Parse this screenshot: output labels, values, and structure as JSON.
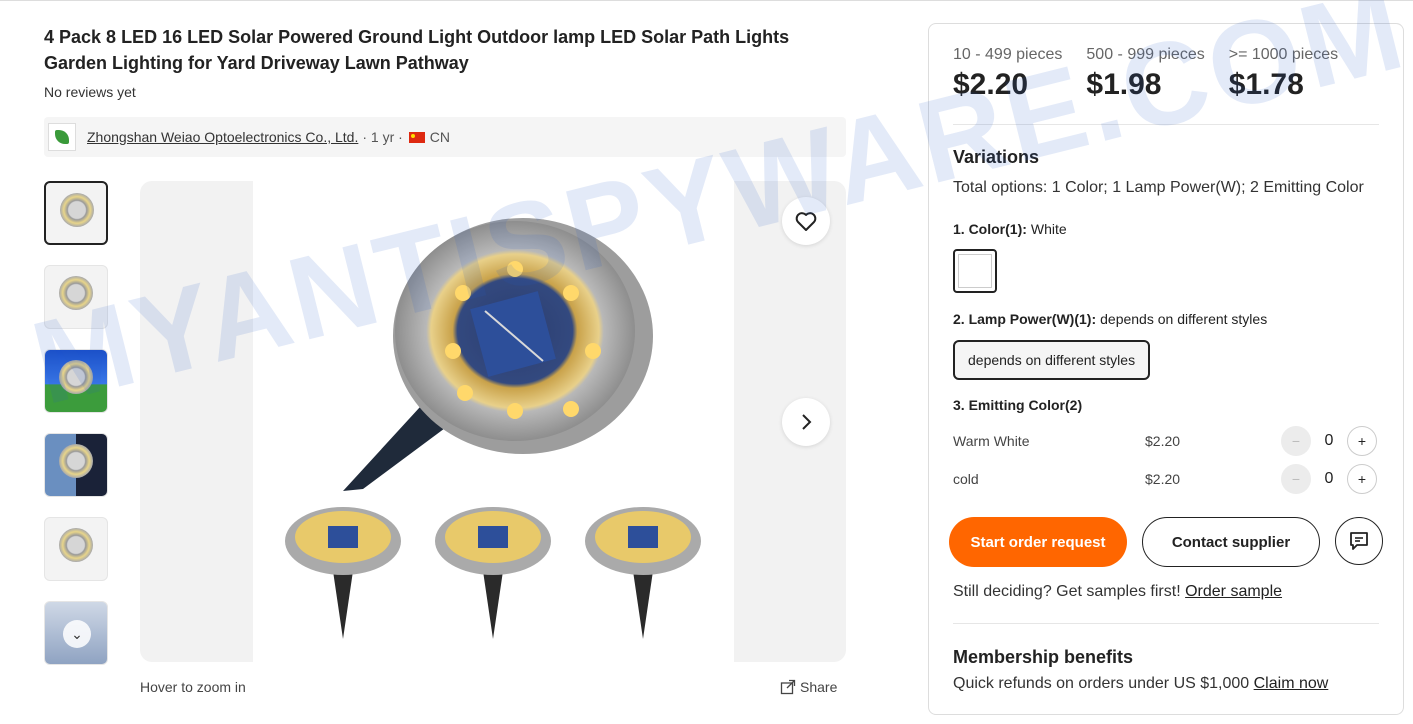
{
  "product": {
    "title": "4 Pack 8 LED 16 LED Solar Powered Ground Light Outdoor lamp LED Solar Path Lights Garden Lighting for Yard Driveway Lawn Pathway",
    "reviews": "No reviews yet"
  },
  "supplier": {
    "name": "Zhongshan Weiao Optoelectronics Co., Ltd.",
    "years": "· 1 yr ·",
    "country": "CN"
  },
  "gallery": {
    "zoom_hint": "Hover to zoom in",
    "share_label": "Share"
  },
  "pricing": {
    "tiers": [
      {
        "range": "10 - 499 pieces",
        "price": "$2.20"
      },
      {
        "range": "500 - 999 pieces",
        "price": "$1.98"
      },
      {
        "range": ">= 1000 pieces",
        "price": "$1.78"
      }
    ]
  },
  "variations": {
    "title": "Variations",
    "total": "Total options: 1 Color; 1 Lamp Power(W); 2 Emitting Color",
    "color_label": "1. Color(1):",
    "color_value": "White",
    "power_label": "2. Lamp Power(W)(1):",
    "power_value": "depends on different styles",
    "power_chip": "depends on different styles",
    "emitting_label": "3. Emitting Color(2)",
    "emitting_options": [
      {
        "name": "Warm White",
        "price": "$2.20",
        "qty": "0"
      },
      {
        "name": "cold",
        "price": "$2.20",
        "qty": "0"
      }
    ]
  },
  "actions": {
    "order": "Start order request",
    "contact": "Contact supplier"
  },
  "samples": {
    "text": "Still deciding? Get samples first!",
    "link": "Order sample"
  },
  "membership": {
    "title": "Membership benefits",
    "text": "Quick refunds on orders under US $1,000",
    "link": "Claim now"
  },
  "watermark": "MYANTISPYWARE.COM",
  "colors": {
    "accent": "#ff6600",
    "led_glow": "#ffd86b"
  }
}
